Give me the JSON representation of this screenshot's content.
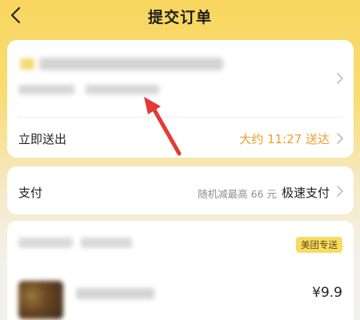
{
  "nav": {
    "title": "提交订单",
    "back_icon": "chevron-left-icon"
  },
  "delivery": {
    "send_now_label": "立即送出",
    "eta_text": "大约 11:27 送达"
  },
  "payment": {
    "label": "支付",
    "promo_text": "随机减最高 66 元",
    "method_text": "极速支付"
  },
  "shop": {
    "tag_label": "美团专送"
  },
  "item": {
    "price": "¥9.9"
  },
  "colors": {
    "accent": "#f19d28",
    "arrow": "#e53935",
    "tag_bg": "#f7dc63"
  }
}
